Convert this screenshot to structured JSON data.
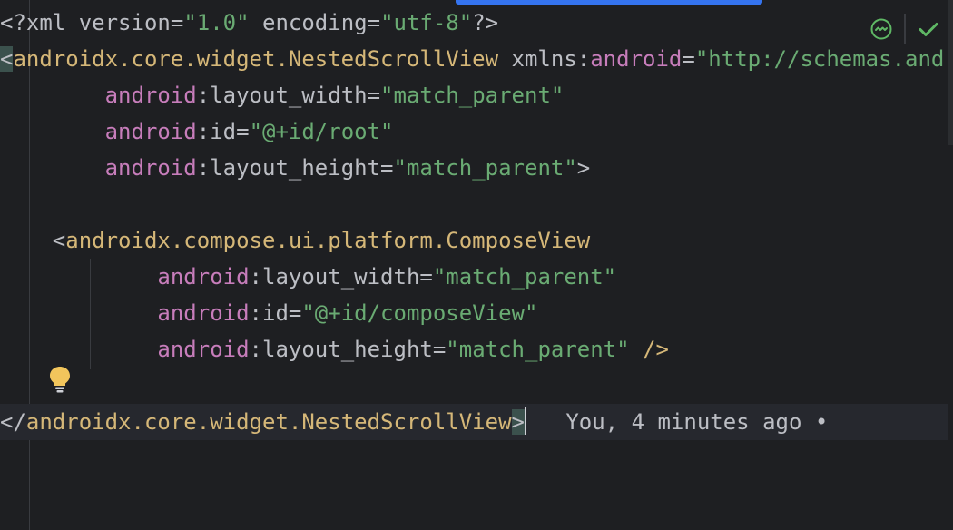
{
  "editor": {
    "lines": [
      {
        "tokens": [
          {
            "t": "<?",
            "c": "punct"
          },
          {
            "t": "xml version",
            "c": "decl"
          },
          {
            "t": "=",
            "c": "punct"
          },
          {
            "t": "\"1.0\"",
            "c": "str"
          },
          {
            "t": " encoding",
            "c": "decl"
          },
          {
            "t": "=",
            "c": "punct"
          },
          {
            "t": "\"utf-8\"",
            "c": "str"
          },
          {
            "t": "?>",
            "c": "punct"
          }
        ]
      },
      {
        "tokens": [
          {
            "t": "<",
            "c": "punct",
            "hl": true
          },
          {
            "t": "androidx.core.widget.NestedScrollView",
            "c": "tag"
          },
          {
            "t": " xmlns",
            "c": "attr"
          },
          {
            "t": ":",
            "c": "punct"
          },
          {
            "t": "android",
            "c": "ns"
          },
          {
            "t": "=",
            "c": "punct"
          },
          {
            "t": "\"http://schemas.android.com/apk/res/android\"",
            "c": "str"
          }
        ]
      },
      {
        "tokens": [
          {
            "t": "        ",
            "c": "punct"
          },
          {
            "t": "android",
            "c": "ns"
          },
          {
            "t": ":",
            "c": "punct"
          },
          {
            "t": "layout_width",
            "c": "attr"
          },
          {
            "t": "=",
            "c": "punct"
          },
          {
            "t": "\"match_parent\"",
            "c": "str"
          }
        ]
      },
      {
        "tokens": [
          {
            "t": "        ",
            "c": "punct"
          },
          {
            "t": "android",
            "c": "ns"
          },
          {
            "t": ":",
            "c": "punct"
          },
          {
            "t": "id",
            "c": "attr"
          },
          {
            "t": "=",
            "c": "punct"
          },
          {
            "t": "\"@+id/root\"",
            "c": "str"
          }
        ]
      },
      {
        "tokens": [
          {
            "t": "        ",
            "c": "punct"
          },
          {
            "t": "android",
            "c": "ns"
          },
          {
            "t": ":",
            "c": "punct"
          },
          {
            "t": "layout_height",
            "c": "attr"
          },
          {
            "t": "=",
            "c": "punct"
          },
          {
            "t": "\"match_parent\"",
            "c": "str"
          },
          {
            "t": ">",
            "c": "punct"
          }
        ]
      },
      {
        "tokens": []
      },
      {
        "tokens": [
          {
            "t": "    ",
            "c": "punct"
          },
          {
            "t": "<",
            "c": "punct"
          },
          {
            "t": "androidx.compose.ui.platform.ComposeView",
            "c": "tag"
          }
        ]
      },
      {
        "tokens": [
          {
            "t": "            ",
            "c": "punct"
          },
          {
            "t": "android",
            "c": "ns"
          },
          {
            "t": ":",
            "c": "punct"
          },
          {
            "t": "layout_width",
            "c": "attr"
          },
          {
            "t": "=",
            "c": "punct"
          },
          {
            "t": "\"match_parent\"",
            "c": "str"
          }
        ]
      },
      {
        "tokens": [
          {
            "t": "            ",
            "c": "punct"
          },
          {
            "t": "android",
            "c": "ns"
          },
          {
            "t": ":",
            "c": "punct"
          },
          {
            "t": "id",
            "c": "attr"
          },
          {
            "t": "=",
            "c": "punct"
          },
          {
            "t": "\"@+id/composeView\"",
            "c": "str"
          }
        ]
      },
      {
        "tokens": [
          {
            "t": "            ",
            "c": "punct"
          },
          {
            "t": "android",
            "c": "ns"
          },
          {
            "t": ":",
            "c": "punct"
          },
          {
            "t": "layout_height",
            "c": "attr"
          },
          {
            "t": "=",
            "c": "punct"
          },
          {
            "t": "\"match_parent\"",
            "c": "str"
          },
          {
            "t": " />",
            "c": "tag"
          }
        ]
      },
      {
        "tokens": []
      },
      {
        "tokens": [
          {
            "t": "</",
            "c": "punct"
          },
          {
            "t": "androidx.core.widget.NestedScrollView",
            "c": "tag"
          },
          {
            "t": ">",
            "c": "punct",
            "hl": true
          },
          {
            "caret": true
          },
          {
            "t": "   You, 4 minutes ago •",
            "c": "blame"
          }
        ]
      }
    ],
    "current_line_index": 11
  },
  "inspection": {
    "status_icon": "inspection-ok-icon",
    "check_icon": "check-icon"
  },
  "gutter": {
    "intention_icon": "lightbulb-icon"
  },
  "colors": {
    "background": "#1e1f22",
    "tag": "#d5b778",
    "namespace": "#c77dbb",
    "string": "#6aab73",
    "text": "#bcbec4",
    "blame": "#6f737a",
    "accent": "#3574f0",
    "ok_green": "#5fb865"
  }
}
